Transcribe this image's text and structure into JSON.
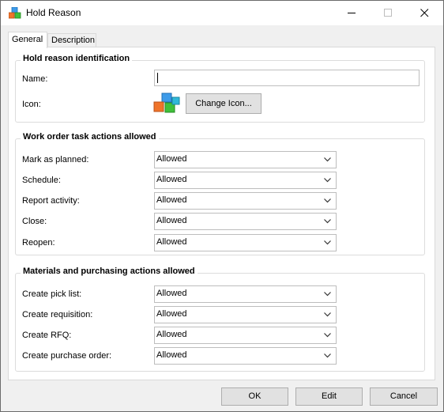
{
  "window": {
    "title": "Hold Reason",
    "icon": "colored-cubes-icon"
  },
  "tabs": [
    {
      "label": "General",
      "active": true
    },
    {
      "label": "Description",
      "active": false
    }
  ],
  "identification": {
    "title": "Hold reason identification",
    "name_label": "Name:",
    "name_value": "",
    "icon_label": "Icon:",
    "change_icon_label": "Change Icon..."
  },
  "work_order": {
    "title": "Work order task actions allowed",
    "rows": [
      {
        "label": "Mark as planned:",
        "value": "Allowed"
      },
      {
        "label": "Schedule:",
        "value": "Allowed"
      },
      {
        "label": "Report activity:",
        "value": "Allowed"
      },
      {
        "label": "Close:",
        "value": "Allowed"
      },
      {
        "label": "Reopen:",
        "value": "Allowed"
      }
    ]
  },
  "materials": {
    "title": "Materials and purchasing actions allowed",
    "rows": [
      {
        "label": "Create pick list:",
        "value": "Allowed"
      },
      {
        "label": "Create requisition:",
        "value": "Allowed"
      },
      {
        "label": "Create RFQ:",
        "value": "Allowed"
      },
      {
        "label": "Create purchase order:",
        "value": "Allowed"
      }
    ]
  },
  "footer": {
    "ok_label": "OK",
    "edit_label": "Edit",
    "cancel_label": "Cancel"
  }
}
